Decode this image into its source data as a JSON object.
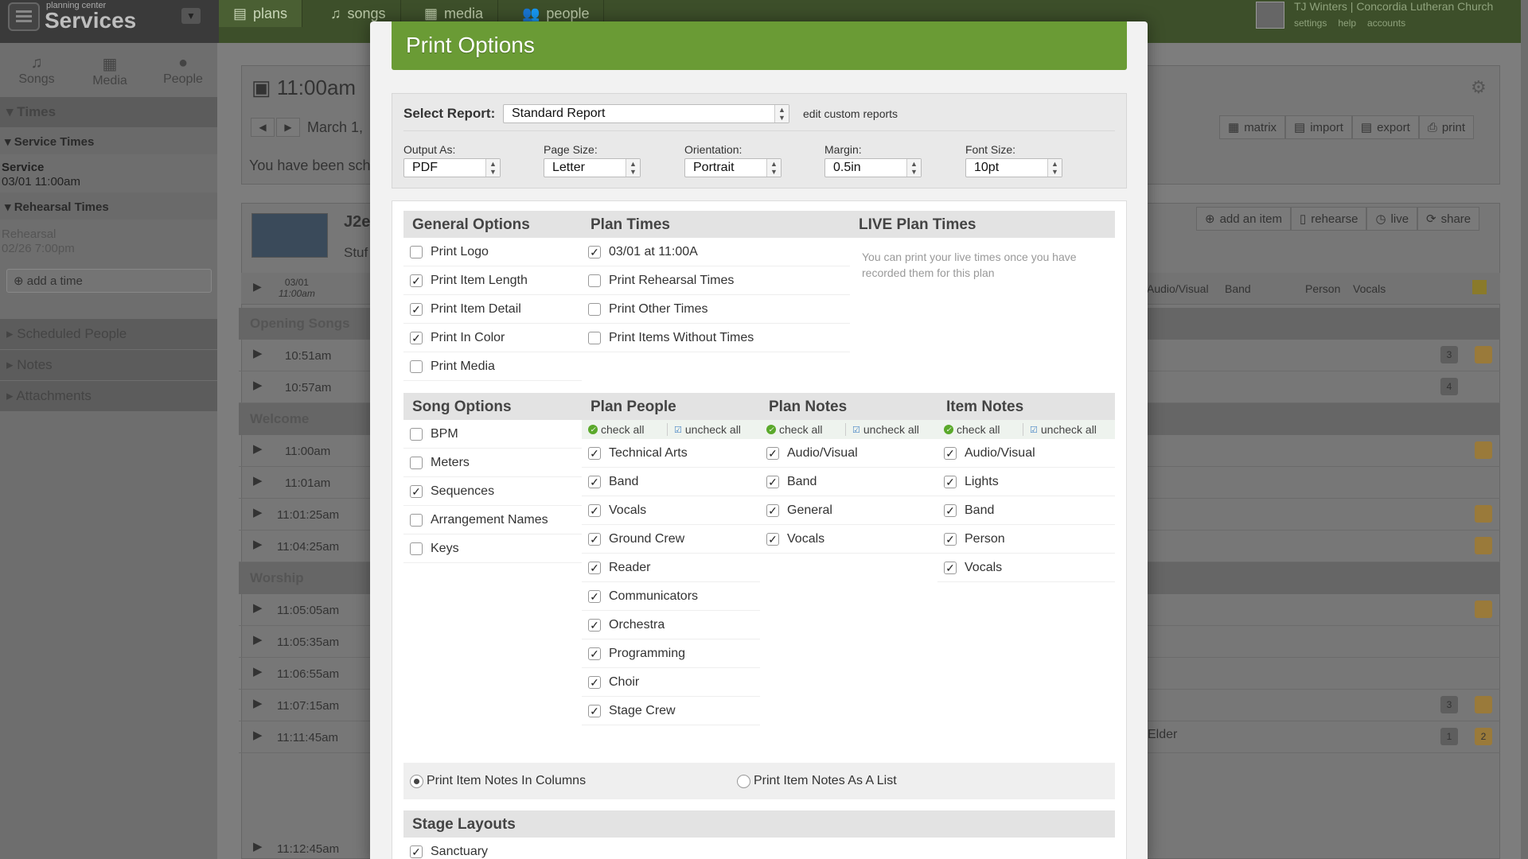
{
  "app": {
    "brand_small": "planning center",
    "brand_name": "Services",
    "top_tabs": [
      {
        "label": "plans",
        "icon": "document-icon"
      },
      {
        "label": "songs",
        "icon": "music-note-icon"
      },
      {
        "label": "media",
        "icon": "film-icon"
      },
      {
        "label": "people",
        "icon": "people-icon"
      }
    ],
    "user": {
      "name": "TJ Winters",
      "org": "Concordia Lutheran Church",
      "links": [
        "settings",
        "help",
        "accounts"
      ]
    }
  },
  "sidebar": {
    "tabs": [
      "Songs",
      "Media",
      "People"
    ],
    "times_header": "Times",
    "service_times_header": "Service Times",
    "service_label": "Service",
    "service_time": "03/01 11:00am",
    "rehearsal_header": "Rehearsal Times",
    "rehearsal_label": "Rehearsal",
    "rehearsal_time": "02/26 7:00pm",
    "add_time": "add a time",
    "sections": [
      "Scheduled People",
      "Notes",
      "Attachments"
    ]
  },
  "main": {
    "plan_time": "11:00am",
    "date_text": "March 1,",
    "toolbar": [
      "matrix",
      "import",
      "export",
      "print"
    ],
    "scheduled_text": "You have been sch",
    "plan_title": "J2e",
    "plan_subtitle": "Stuf",
    "item_toolbar": [
      "add an item",
      "rehearse",
      "live",
      "share"
    ],
    "header_date": "03/01",
    "header_time": "11:00am",
    "columns": [
      "Audio/Visual",
      "Band",
      "Person",
      "Vocals"
    ],
    "sections": [
      {
        "name": "Opening Songs",
        "rows": [
          "10:51am",
          "10:57am"
        ]
      },
      {
        "name": "Welcome",
        "rows": [
          "11:00am",
          "11:01am",
          "11:01:25am",
          "11:04:25am"
        ]
      },
      {
        "name": "Worship",
        "rows": [
          "11:05:05am",
          "11:05:35am",
          "11:06:55am",
          "11:07:15am",
          "11:11:45am"
        ]
      }
    ],
    "last_row_time": "11:12:45am",
    "elder_text": "Elder",
    "badges": [
      "3",
      "4",
      "3",
      "1",
      "2"
    ]
  },
  "modal": {
    "title": "Print Options",
    "select_report_label": "Select Report:",
    "report_value": "Standard Report",
    "edit_custom_reports": "edit custom reports",
    "output": {
      "label": "Output As:",
      "value": "PDF"
    },
    "page_size": {
      "label": "Page Size:",
      "value": "Letter"
    },
    "orientation": {
      "label": "Orientation:",
      "value": "Portrait"
    },
    "margin": {
      "label": "Margin:",
      "value": "0.5in"
    },
    "font_size": {
      "label": "Font Size:",
      "value": "10pt"
    },
    "general_options": {
      "title": "General Options",
      "items": [
        {
          "label": "Print Logo",
          "checked": false
        },
        {
          "label": "Print Item Length",
          "checked": true
        },
        {
          "label": "Print Item Detail",
          "checked": true
        },
        {
          "label": "Print In Color",
          "checked": true
        },
        {
          "label": "Print Media",
          "checked": false
        }
      ]
    },
    "plan_times": {
      "title": "Plan Times",
      "items": [
        {
          "label": "03/01 at 11:00A",
          "checked": true
        },
        {
          "label": "Print Rehearsal Times",
          "checked": false
        },
        {
          "label": "Print Other Times",
          "checked": false
        },
        {
          "label": "Print Items Without Times",
          "checked": false
        }
      ]
    },
    "live_plan_times": {
      "title": "LIVE Plan Times",
      "note": "You can print your live times once you have recorded them for this plan"
    },
    "song_options": {
      "title": "Song Options",
      "items": [
        {
          "label": "BPM",
          "checked": false
        },
        {
          "label": "Meters",
          "checked": false
        },
        {
          "label": "Sequences",
          "checked": true
        },
        {
          "label": "Arrangement Names",
          "checked": false
        },
        {
          "label": "Keys",
          "checked": false
        }
      ]
    },
    "check_all": "check all",
    "uncheck_all": "uncheck all",
    "plan_people": {
      "title": "Plan People",
      "items": [
        "Technical Arts",
        "Band",
        "Vocals",
        "Ground Crew",
        "Reader",
        "Communicators",
        "Orchestra",
        "Programming",
        "Choir",
        "Stage Crew"
      ]
    },
    "plan_notes": {
      "title": "Plan Notes",
      "items": [
        "Audio/Visual",
        "Band",
        "General",
        "Vocals"
      ]
    },
    "item_notes": {
      "title": "Item Notes",
      "items": [
        "Audio/Visual",
        "Lights",
        "Band",
        "Person",
        "Vocals"
      ]
    },
    "notes_columns": {
      "label": "Print Item Notes In Columns",
      "selected": true
    },
    "notes_list": {
      "label": "Print Item Notes As A List",
      "selected": false
    },
    "stage_layouts": {
      "title": "Stage Layouts",
      "items": [
        {
          "label": "Sanctuary",
          "checked": true
        }
      ]
    }
  },
  "colors": {
    "modal_header": "#6a9b35",
    "check_all_dot": "#5aa92b",
    "badge_orange": "#b8862a"
  }
}
